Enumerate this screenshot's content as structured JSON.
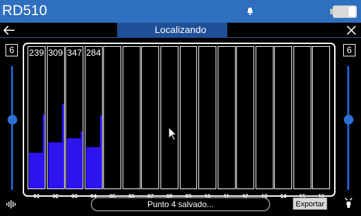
{
  "device": {
    "title": "RD510"
  },
  "header": {
    "title": "Localizando"
  },
  "levels": {
    "left": "6",
    "right": "6"
  },
  "sliders": {
    "left_position": 0.43,
    "right_position": 0.43
  },
  "graph": {
    "channels": [
      {
        "label": "01",
        "value": "239",
        "level": 0.25,
        "spike": 0.52
      },
      {
        "label": "02",
        "value": "309",
        "level": 0.32,
        "spike": 0.59
      },
      {
        "label": "03",
        "value": "347",
        "level": 0.35,
        "spike": 0.4
      },
      {
        "label": "04",
        "value": "284",
        "level": 0.29,
        "spike": 0.51
      },
      {
        "label": "05",
        "value": "",
        "level": 0,
        "spike": 0
      },
      {
        "label": "06",
        "value": "",
        "level": 0,
        "spike": 0
      },
      {
        "label": "07",
        "value": "",
        "level": 0,
        "spike": 0
      },
      {
        "label": "08",
        "value": "",
        "level": 0,
        "spike": 0
      },
      {
        "label": "09",
        "value": "",
        "level": 0,
        "spike": 0
      },
      {
        "label": "10",
        "value": "",
        "level": 0,
        "spike": 0
      },
      {
        "label": "11",
        "value": "",
        "level": 0,
        "spike": 0
      },
      {
        "label": "12",
        "value": "",
        "level": 0,
        "spike": 0
      },
      {
        "label": "13",
        "value": "",
        "level": 0,
        "spike": 0
      },
      {
        "label": "14",
        "value": "",
        "level": 0,
        "spike": 0
      },
      {
        "label": "15",
        "value": "",
        "level": 0,
        "spike": 0
      },
      {
        "label": "16",
        "value": "",
        "level": 0,
        "spike": 0
      }
    ]
  },
  "status": {
    "message": "Punto 4 salvado..."
  },
  "actions": {
    "export_label": "Exportar"
  },
  "colors": {
    "accent": "#2f6fc0",
    "bar": "#2d14f0",
    "slider": "#2c6fd6"
  },
  "icons": {
    "back": "arrow-left-icon",
    "close": "close-icon",
    "bell": "bell-icon",
    "battery": "battery-icon",
    "signal": "signal-icon",
    "bulb": "lamp-icon"
  }
}
